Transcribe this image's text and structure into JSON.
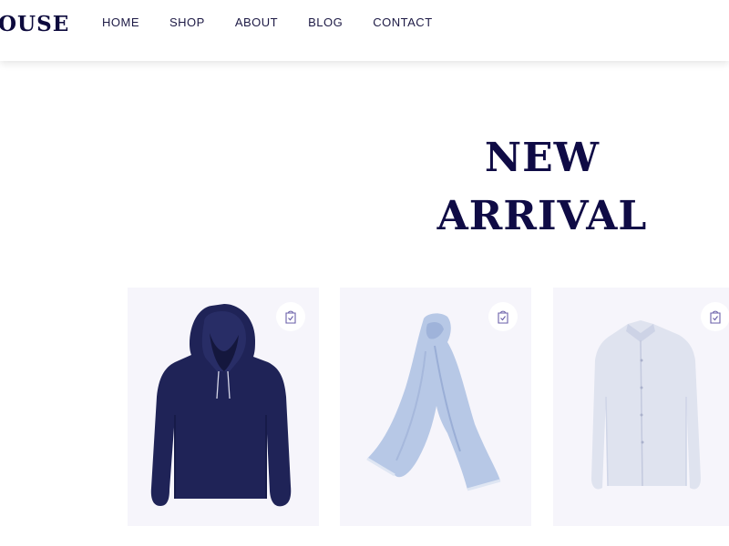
{
  "header": {
    "logo": "OUSE",
    "nav": [
      "HOME",
      "SHOP",
      "ABOUT",
      "BLOG",
      "CONTACT"
    ]
  },
  "hero": {
    "title_line1": "NEW",
    "title_line2": "ARRIVAL"
  },
  "products": [
    {
      "image": "navy-hoodie",
      "cart_icon": "shopping-bag-check-icon"
    },
    {
      "image": "light-blue-scarf",
      "cart_icon": "shopping-bag-check-icon"
    },
    {
      "image": "white-dress-shirt",
      "cart_icon": "shopping-bag-check-icon"
    }
  ],
  "colors": {
    "brand_dark": "#0d0a3d",
    "card_bg": "#f6f5fb",
    "icon_accent": "#6a5fa8"
  }
}
